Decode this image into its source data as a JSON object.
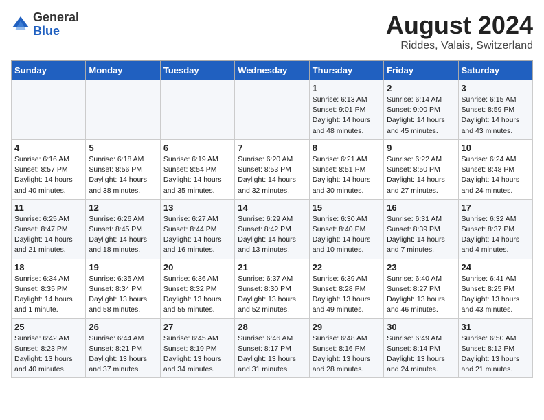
{
  "header": {
    "logo_general": "General",
    "logo_blue": "Blue",
    "title": "August 2024",
    "subtitle": "Riddes, Valais, Switzerland"
  },
  "days_of_week": [
    "Sunday",
    "Monday",
    "Tuesday",
    "Wednesday",
    "Thursday",
    "Friday",
    "Saturday"
  ],
  "weeks": [
    [
      {
        "day": "",
        "info": ""
      },
      {
        "day": "",
        "info": ""
      },
      {
        "day": "",
        "info": ""
      },
      {
        "day": "",
        "info": ""
      },
      {
        "day": "1",
        "info": "Sunrise: 6:13 AM\nSunset: 9:01 PM\nDaylight: 14 hours and 48 minutes."
      },
      {
        "day": "2",
        "info": "Sunrise: 6:14 AM\nSunset: 9:00 PM\nDaylight: 14 hours and 45 minutes."
      },
      {
        "day": "3",
        "info": "Sunrise: 6:15 AM\nSunset: 8:59 PM\nDaylight: 14 hours and 43 minutes."
      }
    ],
    [
      {
        "day": "4",
        "info": "Sunrise: 6:16 AM\nSunset: 8:57 PM\nDaylight: 14 hours and 40 minutes."
      },
      {
        "day": "5",
        "info": "Sunrise: 6:18 AM\nSunset: 8:56 PM\nDaylight: 14 hours and 38 minutes."
      },
      {
        "day": "6",
        "info": "Sunrise: 6:19 AM\nSunset: 8:54 PM\nDaylight: 14 hours and 35 minutes."
      },
      {
        "day": "7",
        "info": "Sunrise: 6:20 AM\nSunset: 8:53 PM\nDaylight: 14 hours and 32 minutes."
      },
      {
        "day": "8",
        "info": "Sunrise: 6:21 AM\nSunset: 8:51 PM\nDaylight: 14 hours and 30 minutes."
      },
      {
        "day": "9",
        "info": "Sunrise: 6:22 AM\nSunset: 8:50 PM\nDaylight: 14 hours and 27 minutes."
      },
      {
        "day": "10",
        "info": "Sunrise: 6:24 AM\nSunset: 8:48 PM\nDaylight: 14 hours and 24 minutes."
      }
    ],
    [
      {
        "day": "11",
        "info": "Sunrise: 6:25 AM\nSunset: 8:47 PM\nDaylight: 14 hours and 21 minutes."
      },
      {
        "day": "12",
        "info": "Sunrise: 6:26 AM\nSunset: 8:45 PM\nDaylight: 14 hours and 18 minutes."
      },
      {
        "day": "13",
        "info": "Sunrise: 6:27 AM\nSunset: 8:44 PM\nDaylight: 14 hours and 16 minutes."
      },
      {
        "day": "14",
        "info": "Sunrise: 6:29 AM\nSunset: 8:42 PM\nDaylight: 14 hours and 13 minutes."
      },
      {
        "day": "15",
        "info": "Sunrise: 6:30 AM\nSunset: 8:40 PM\nDaylight: 14 hours and 10 minutes."
      },
      {
        "day": "16",
        "info": "Sunrise: 6:31 AM\nSunset: 8:39 PM\nDaylight: 14 hours and 7 minutes."
      },
      {
        "day": "17",
        "info": "Sunrise: 6:32 AM\nSunset: 8:37 PM\nDaylight: 14 hours and 4 minutes."
      }
    ],
    [
      {
        "day": "18",
        "info": "Sunrise: 6:34 AM\nSunset: 8:35 PM\nDaylight: 14 hours and 1 minute."
      },
      {
        "day": "19",
        "info": "Sunrise: 6:35 AM\nSunset: 8:34 PM\nDaylight: 13 hours and 58 minutes."
      },
      {
        "day": "20",
        "info": "Sunrise: 6:36 AM\nSunset: 8:32 PM\nDaylight: 13 hours and 55 minutes."
      },
      {
        "day": "21",
        "info": "Sunrise: 6:37 AM\nSunset: 8:30 PM\nDaylight: 13 hours and 52 minutes."
      },
      {
        "day": "22",
        "info": "Sunrise: 6:39 AM\nSunset: 8:28 PM\nDaylight: 13 hours and 49 minutes."
      },
      {
        "day": "23",
        "info": "Sunrise: 6:40 AM\nSunset: 8:27 PM\nDaylight: 13 hours and 46 minutes."
      },
      {
        "day": "24",
        "info": "Sunrise: 6:41 AM\nSunset: 8:25 PM\nDaylight: 13 hours and 43 minutes."
      }
    ],
    [
      {
        "day": "25",
        "info": "Sunrise: 6:42 AM\nSunset: 8:23 PM\nDaylight: 13 hours and 40 minutes."
      },
      {
        "day": "26",
        "info": "Sunrise: 6:44 AM\nSunset: 8:21 PM\nDaylight: 13 hours and 37 minutes."
      },
      {
        "day": "27",
        "info": "Sunrise: 6:45 AM\nSunset: 8:19 PM\nDaylight: 13 hours and 34 minutes."
      },
      {
        "day": "28",
        "info": "Sunrise: 6:46 AM\nSunset: 8:17 PM\nDaylight: 13 hours and 31 minutes."
      },
      {
        "day": "29",
        "info": "Sunrise: 6:48 AM\nSunset: 8:16 PM\nDaylight: 13 hours and 28 minutes."
      },
      {
        "day": "30",
        "info": "Sunrise: 6:49 AM\nSunset: 8:14 PM\nDaylight: 13 hours and 24 minutes."
      },
      {
        "day": "31",
        "info": "Sunrise: 6:50 AM\nSunset: 8:12 PM\nDaylight: 13 hours and 21 minutes."
      }
    ]
  ]
}
